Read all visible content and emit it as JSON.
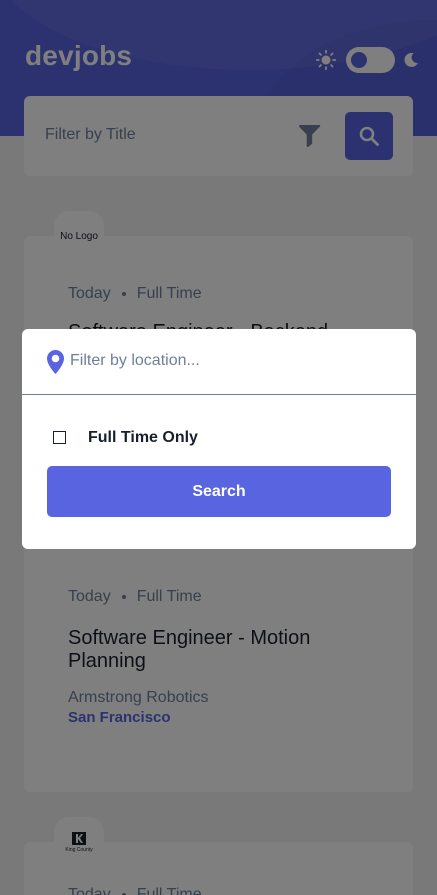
{
  "header": {
    "logo": "devjobs",
    "theme_toggle_state": "light"
  },
  "filter_bar": {
    "title_placeholder": "Filter by Title"
  },
  "jobs": [
    {
      "logo_text": "No Logo",
      "posted": "Today",
      "contract": "Full Time",
      "title": "Software Engineer - Backend",
      "company": "",
      "location": ""
    },
    {
      "logo_text": "",
      "posted": "Today",
      "contract": "Full Time",
      "title": "Software Engineer - Motion Planning",
      "company": "Armstrong Robotics",
      "location": "San Francisco"
    },
    {
      "logo_text": "King County",
      "posted": "Today",
      "contract": "Full Time",
      "title": "",
      "company": "",
      "location": ""
    }
  ],
  "modal": {
    "location_placeholder": "Filter by location...",
    "location_value": "",
    "full_time_label": "Full Time Only",
    "full_time_checked": false,
    "search_label": "Search"
  },
  "colors": {
    "accent": "#5964e0",
    "text_dark": "#19202d",
    "text_gray": "#6e8098",
    "background": "#f2f2f2"
  }
}
